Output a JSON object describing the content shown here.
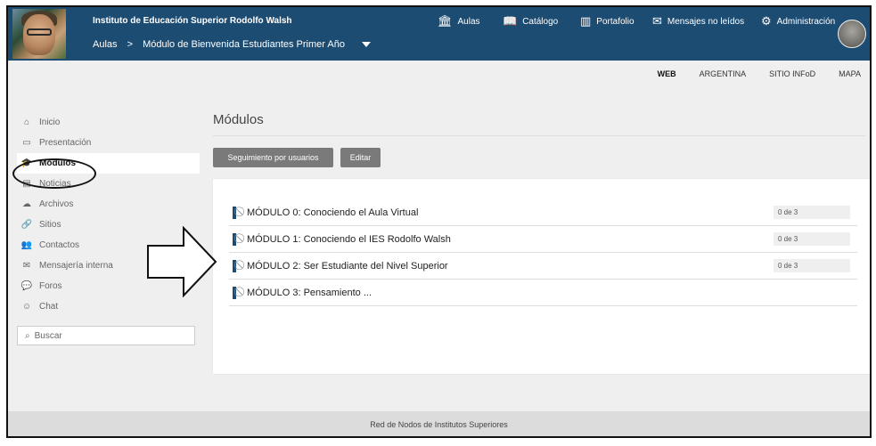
{
  "header": {
    "site_title": "Instituto de Educación Superior Rodolfo Walsh",
    "breadcrumb": [
      "Aulas",
      ">",
      "Módulo de Bienvenida Estudiantes Primer Año"
    ],
    "nav": [
      {
        "icon": "institution-icon",
        "label": "Aulas"
      },
      {
        "icon": "book-icon",
        "label": "Catálogo"
      },
      {
        "icon": "portfolio-icon",
        "label": "Portafolio"
      },
      {
        "icon": "mail-icon",
        "label": "Mensajes no leídos"
      },
      {
        "icon": "gear-icon",
        "label": "Administración"
      }
    ]
  },
  "sublinks": [
    "WEB",
    "ARGENTINA",
    "SITIO INFoD",
    "MAPA"
  ],
  "sidebar": {
    "items": [
      {
        "icon": "home-icon",
        "label": "Inicio"
      },
      {
        "icon": "monitor-icon",
        "label": "Presentación"
      },
      {
        "icon": "graduation-cap-icon",
        "label": "Módulos"
      },
      {
        "icon": "newspaper-icon",
        "label": "Noticias"
      },
      {
        "icon": "cloud-icon",
        "label": "Archivos"
      },
      {
        "icon": "link-icon",
        "label": "Sitios"
      },
      {
        "icon": "contacts-icon",
        "label": "Contactos"
      },
      {
        "icon": "envelope-icon",
        "label": "Mensajería interna"
      },
      {
        "icon": "forum-icon",
        "label": "Foros"
      },
      {
        "icon": "chat-icon",
        "label": "Chat"
      }
    ],
    "search_label": "Buscar"
  },
  "main": {
    "title": "Módulos",
    "buttons": {
      "tracking": "Seguimiento por usuarios",
      "edit": "Editar"
    },
    "modules": [
      {
        "label": "MÓDULO 0: Conociendo el Aula Virtual",
        "progress": "0 de 3"
      },
      {
        "label": "MÓDULO 1: Conociendo el IES Rodolfo Walsh",
        "progress": "0 de 3"
      },
      {
        "label": "MÓDULO 2: Ser Estudiante del Nivel Superior",
        "progress": "0 de 3"
      },
      {
        "label": "MÓDULO 3: Pensamiento ...",
        "progress": ""
      }
    ]
  },
  "footer": {
    "text": "Red de Nodos de Institutos Superiores"
  },
  "colors": {
    "header_bg": "#1d4c73",
    "button_bg": "#7a7a7a",
    "page_bg": "#efefef"
  }
}
